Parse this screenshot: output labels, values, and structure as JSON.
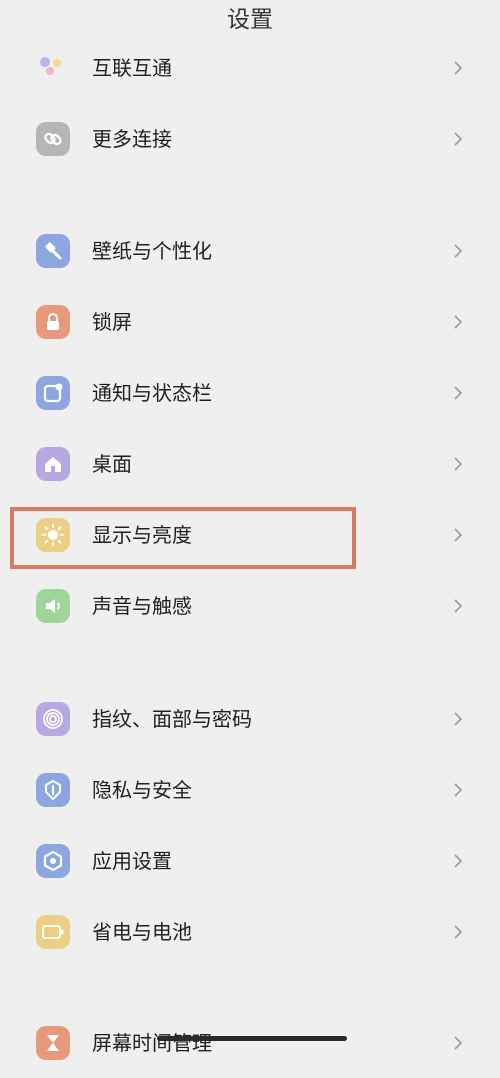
{
  "header": {
    "title": "设置"
  },
  "items": [
    {
      "id": "hulian",
      "label": "互联互通",
      "icon": "dots-icon",
      "color": "#b9b3e8"
    },
    {
      "id": "more",
      "label": "更多连接",
      "icon": "link-icon",
      "color": "#b6b6b6"
    },
    {
      "id": "wallpaper",
      "label": "壁纸与个性化",
      "icon": "brush-icon",
      "color": "#8da6df"
    },
    {
      "id": "lock",
      "label": "锁屏",
      "icon": "lock-icon",
      "color": "#e6997b"
    },
    {
      "id": "notify",
      "label": "通知与状态栏",
      "icon": "notification-icon",
      "color": "#8da6df"
    },
    {
      "id": "desktop",
      "label": "桌面",
      "icon": "home-icon",
      "color": "#b7a8e2"
    },
    {
      "id": "display",
      "label": "显示与亮度",
      "icon": "sun-icon",
      "color": "#ebcf84"
    },
    {
      "id": "sound",
      "label": "声音与触感",
      "icon": "speaker-icon",
      "color": "#9fd59a"
    },
    {
      "id": "biometric",
      "label": "指纹、面部与密码",
      "icon": "fingerprint-icon",
      "color": "#b7a8e2"
    },
    {
      "id": "privacy",
      "label": "隐私与安全",
      "icon": "shield-icon",
      "color": "#8da6df"
    },
    {
      "id": "apps",
      "label": "应用设置",
      "icon": "hexagon-icon",
      "color": "#8da6df"
    },
    {
      "id": "battery",
      "label": "省电与电池",
      "icon": "battery-icon",
      "color": "#ebcf84"
    },
    {
      "id": "screentime",
      "label": "屏幕时间管理",
      "icon": "hourglass-icon",
      "color": "#e6997b"
    }
  ],
  "highlight_color": "#d77b62"
}
